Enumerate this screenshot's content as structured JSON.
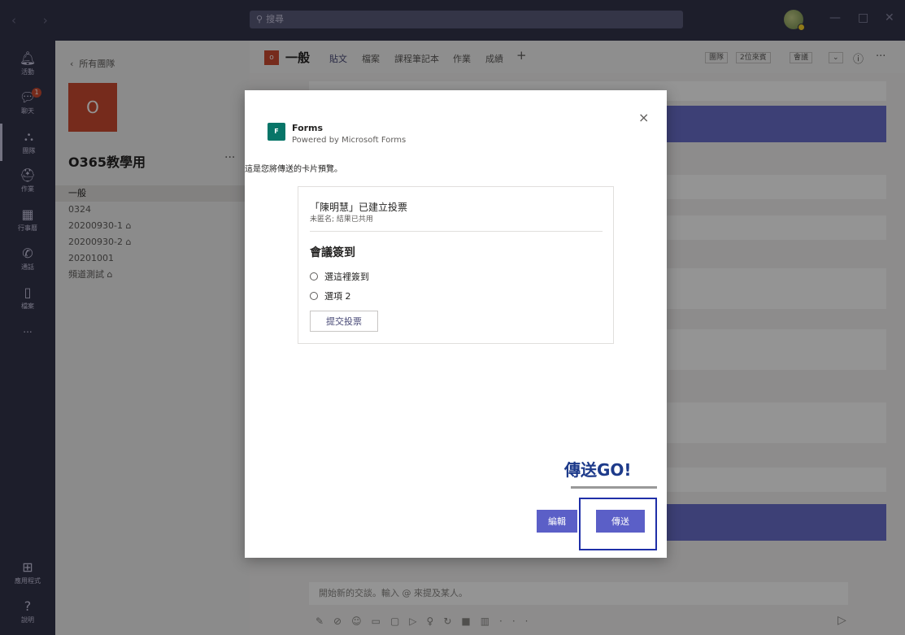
{
  "titlebar": {
    "search_placeholder": "搜尋"
  },
  "rail": {
    "items": [
      {
        "label": "活動"
      },
      {
        "label": "聊天",
        "badge": "1"
      },
      {
        "label": "團隊"
      },
      {
        "label": "作業"
      },
      {
        "label": "行事曆"
      },
      {
        "label": "通話"
      },
      {
        "label": "檔案"
      },
      {
        "label": "..."
      },
      {
        "label": "應用程式"
      },
      {
        "label": "說明"
      }
    ]
  },
  "team": {
    "back": "所有團隊",
    "tile_letter": "O",
    "name": "O365教學用",
    "more": "···",
    "channels": [
      "一般",
      "0324",
      "20200930-1 ⌂",
      "20200930-2 ⌂",
      "20201001",
      "頻道測試 ⌂"
    ]
  },
  "channel": {
    "tile_letter": "o",
    "name": "一般",
    "tabs": [
      "貼文",
      "檔案",
      "課程筆記本",
      "作業",
      "成績",
      "+"
    ],
    "pills": [
      "團隊",
      "2位來賓",
      "會議"
    ]
  },
  "compose": {
    "placeholder": "開始新的交談。輸入 @ 來提及某人。"
  },
  "modal": {
    "app_title": "Forms",
    "app_subtitle": "Powered by Microsoft Forms",
    "close": "×",
    "preview_label": "這是您將傳送的卡片預覽。",
    "poll_creator": "「陳明慧」已建立投票",
    "poll_meta": "未匿名; 結果已共用",
    "poll_question": "會議簽到",
    "options": [
      "選這裡簽到",
      "選項 2"
    ],
    "submit_label": "提交投票",
    "edit_label": "編輯",
    "send_label": "傳送"
  },
  "annotation": {
    "text": "傳送GO!"
  }
}
